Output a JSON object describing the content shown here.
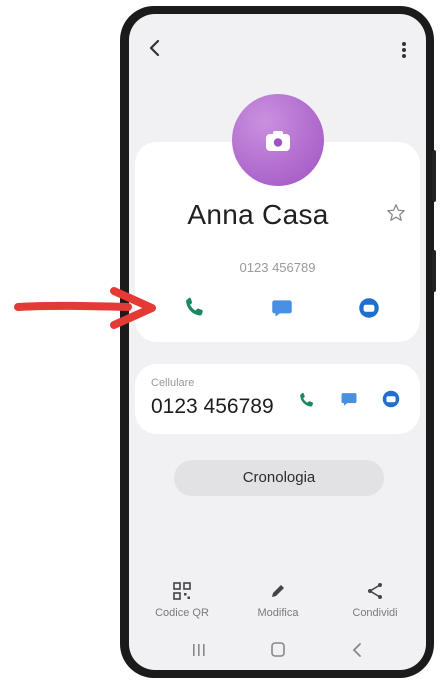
{
  "contact": {
    "name": "Anna Casa",
    "phone": "0123 456789"
  },
  "mobile": {
    "label": "Cellulare",
    "number": "0123 456789"
  },
  "history_label": "Cronologia",
  "bottom_actions": [
    {
      "icon": "qr-code-icon",
      "label": "Codice QR"
    },
    {
      "icon": "pencil-icon",
      "label": "Modifica"
    },
    {
      "icon": "share-icon",
      "label": "Condividi"
    }
  ],
  "colors": {
    "avatar": "#a052c2",
    "call_green": "#1a8a5c",
    "message_blue": "#4a90e2",
    "video_blue": "#1f6fd1",
    "arrow_red": "#e53935"
  },
  "icons": {
    "top_left": "back-arrow-icon",
    "top_right": "more-options-icon",
    "favorite": "star-icon",
    "call": "phone-icon",
    "message": "message-icon",
    "video": "video-call-icon"
  }
}
